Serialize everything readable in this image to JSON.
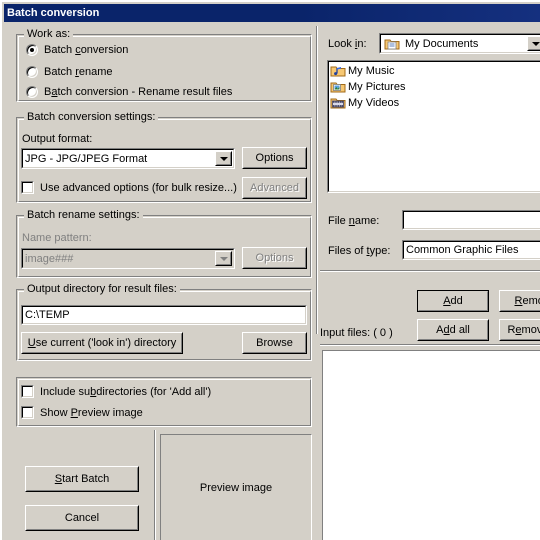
{
  "window": {
    "title": "Batch conversion",
    "titlebar_color": "#0a246a",
    "face_color": "#d4d0c8"
  },
  "work_as": {
    "legend": "Work as:",
    "options": [
      {
        "label_pre": "Batch ",
        "accel": "c",
        "label_post": "onversion",
        "selected": true
      },
      {
        "label_pre": "Batch ",
        "accel": "r",
        "label_post": "ename",
        "selected": false
      },
      {
        "label_pre": "B",
        "accel": "a",
        "label_post": "tch conversion - Rename result files",
        "selected": false
      }
    ]
  },
  "conversion_settings": {
    "legend": "Batch conversion settings:",
    "output_format_label": "Output format:",
    "output_format_value": "JPG - JPG/JPEG Format",
    "options_button": "Options",
    "advanced_checkbox_pre": "Use advanced options (for bulk resize...)",
    "advanced_checkbox_accel": "",
    "advanced_checked": false,
    "advanced_button": "Advanced"
  },
  "rename_settings": {
    "legend": "Batch rename settings:",
    "name_pattern_label": "Name pattern:",
    "name_pattern_value": "image###",
    "options_button": "Options",
    "disabled": true
  },
  "output_directory": {
    "legend": "Output directory for result files:",
    "path_value": "C:\\TEMP",
    "use_current_pre": "U",
    "use_current_accel": "U",
    "use_current_button": "Use current ('look in') directory",
    "browse_button": "Browse"
  },
  "extra_options": {
    "include_subdirs_label": "Include subdirectories (for 'Add all')",
    "include_subdirs_checked": false,
    "show_preview_label": "Show Preview image",
    "show_preview_checked": false
  },
  "actions": {
    "start_batch": "Start Batch",
    "cancel": "Cancel"
  },
  "preview": {
    "placeholder": "Preview image"
  },
  "file_browser": {
    "look_in_label": "Look in:",
    "look_in_value": "My Documents",
    "look_in_icon": "folder-documents-icon",
    "items": [
      {
        "name": "My Music",
        "icon": "folder-music-icon"
      },
      {
        "name": "My Pictures",
        "icon": "folder-pictures-icon"
      },
      {
        "name": "My Videos",
        "icon": "folder-videos-icon"
      }
    ],
    "file_name_label": "File name:",
    "file_name_value": "",
    "files_of_type_label": "Files of type:",
    "files_of_type_value": "Common Graphic Files",
    "add_button": "Add",
    "add_all_button": "Add all",
    "remove_button": "Remove",
    "remove_all_button": "Remove all",
    "input_files_label": "Input files: ( 0 )"
  }
}
